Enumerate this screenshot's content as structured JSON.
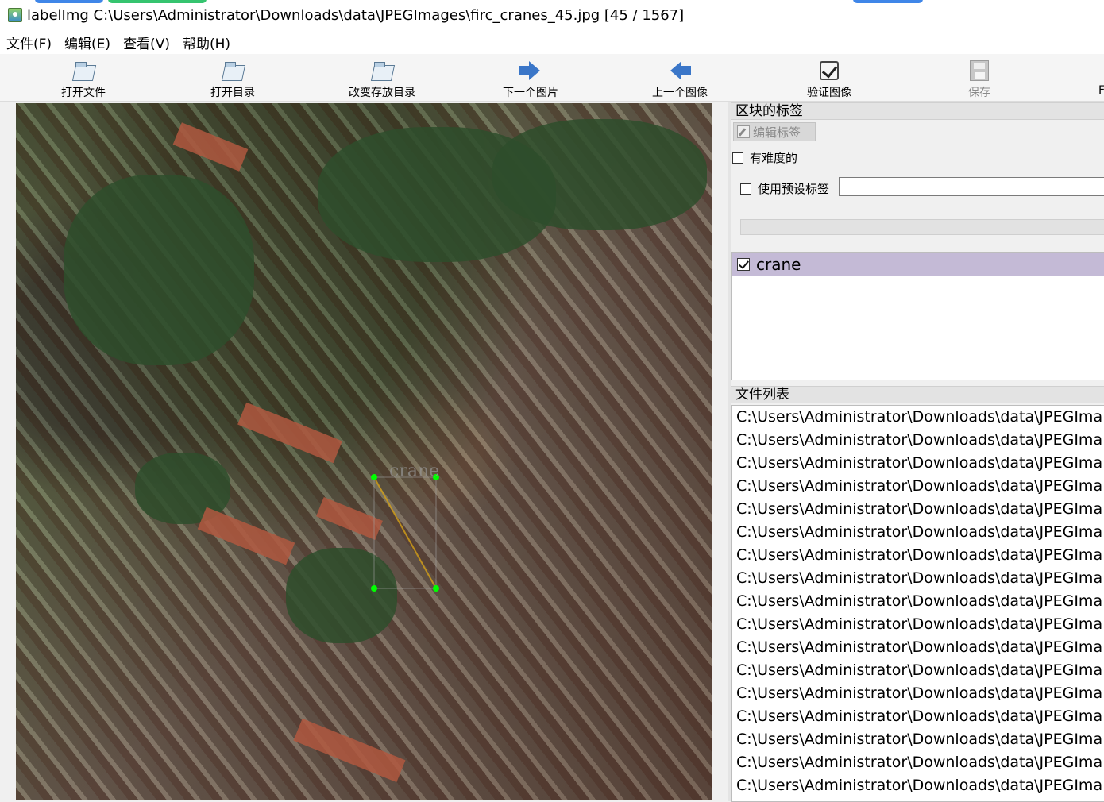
{
  "window": {
    "title": "labelImg C:\\Users\\Administrator\\Downloads\\data\\JPEGImages\\firc_cranes_45.jpg [45 / 1567]"
  },
  "menu": [
    "文件(F)",
    "编辑(E)",
    "查看(V)",
    "帮助(H)"
  ],
  "toolbar": {
    "open_file": "打开文件",
    "open_dir": "打开目录",
    "change_save_dir": "改变存放目录",
    "next_image": "下一个图片",
    "prev_image": "上一个图像",
    "verify_image": "验证图像",
    "save": "保存",
    "truncated": "F"
  },
  "canvas": {
    "box_label": "crane",
    "box_color": "#00ff00",
    "diagonal_color": "#d4a017"
  },
  "box_labels_panel": {
    "title": "区块的标签",
    "edit_label_button": "编辑标签",
    "difficult_label": "有难度的",
    "use_default_label": "使用预设标签",
    "default_label_value": "",
    "labels": [
      {
        "name": "crane",
        "checked": true
      }
    ]
  },
  "file_list_panel": {
    "title": "文件列表",
    "files": [
      "C:\\Users\\Administrator\\Downloads\\data\\JPEGIma",
      "C:\\Users\\Administrator\\Downloads\\data\\JPEGIma",
      "C:\\Users\\Administrator\\Downloads\\data\\JPEGIma",
      "C:\\Users\\Administrator\\Downloads\\data\\JPEGIma",
      "C:\\Users\\Administrator\\Downloads\\data\\JPEGIma",
      "C:\\Users\\Administrator\\Downloads\\data\\JPEGIma",
      "C:\\Users\\Administrator\\Downloads\\data\\JPEGIma",
      "C:\\Users\\Administrator\\Downloads\\data\\JPEGIma",
      "C:\\Users\\Administrator\\Downloads\\data\\JPEGIma",
      "C:\\Users\\Administrator\\Downloads\\data\\JPEGIma",
      "C:\\Users\\Administrator\\Downloads\\data\\JPEGIma",
      "C:\\Users\\Administrator\\Downloads\\data\\JPEGIma",
      "C:\\Users\\Administrator\\Downloads\\data\\JPEGIma",
      "C:\\Users\\Administrator\\Downloads\\data\\JPEGIma",
      "C:\\Users\\Administrator\\Downloads\\data\\JPEGIma",
      "C:\\Users\\Administrator\\Downloads\\data\\JPEGIma",
      "C:\\Users\\Administrator\\Downloads\\data\\JPEGIma"
    ]
  }
}
